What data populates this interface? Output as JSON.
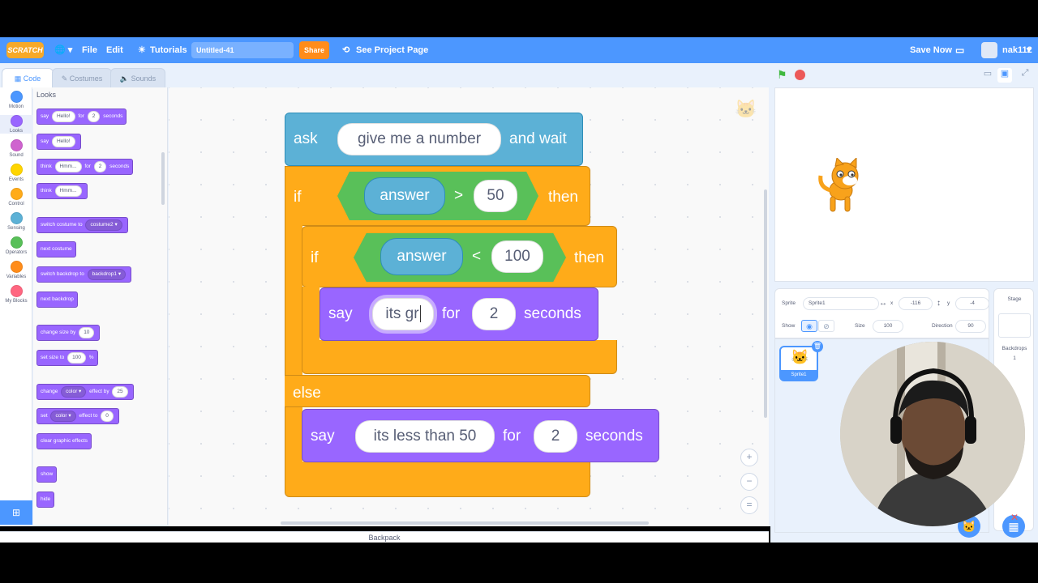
{
  "menubar": {
    "logo": "SCRATCH",
    "file": "File",
    "edit": "Edit",
    "tutorials": "Tutorials",
    "project_title": "Untitled-41",
    "share": "Share",
    "see_project_page": "See Project Page",
    "save_now": "Save Now",
    "username": "nak112"
  },
  "tabs": {
    "code": "Code",
    "costumes": "Costumes",
    "sounds": "Sounds"
  },
  "categories": [
    {
      "label": "Motion",
      "color": "#4c97ff"
    },
    {
      "label": "Looks",
      "color": "#9966ff"
    },
    {
      "label": "Sound",
      "color": "#cf63cf"
    },
    {
      "label": "Events",
      "color": "#ffd500"
    },
    {
      "label": "Control",
      "color": "#ffab19"
    },
    {
      "label": "Sensing",
      "color": "#5cb1d6"
    },
    {
      "label": "Operators",
      "color": "#59c059"
    },
    {
      "label": "Variables",
      "color": "#ff8c1a"
    },
    {
      "label": "My Blocks",
      "color": "#ff6680"
    }
  ],
  "palette": {
    "heading": "Looks",
    "say_for": {
      "say": "say",
      "msg": "Hello!",
      "for": "for",
      "secs": "2",
      "seconds": "seconds"
    },
    "say": {
      "say": "say",
      "msg": "Hello!"
    },
    "think_for": {
      "think": "think",
      "msg": "Hmm...",
      "for": "for",
      "secs": "2",
      "seconds": "seconds"
    },
    "think": {
      "think": "think",
      "msg": "Hmm..."
    },
    "switch_costume": {
      "label": "switch costume to",
      "value": "costume2"
    },
    "next_costume": "next costume",
    "switch_backdrop": {
      "label": "switch backdrop to",
      "value": "backdrop1"
    },
    "next_backdrop": "next backdrop",
    "change_size": {
      "label": "change size by",
      "value": "10"
    },
    "set_size": {
      "label": "set size to",
      "value": "100",
      "unit": "%"
    },
    "change_effect": {
      "change": "change",
      "effect": "color",
      "by": "effect by",
      "value": "25"
    },
    "set_effect": {
      "set": "set",
      "effect": "color",
      "to": "effect to",
      "value": "0"
    },
    "clear_effects": "clear graphic effects",
    "show": "show",
    "hide": "hide"
  },
  "script": {
    "ask": {
      "ask": "ask",
      "question": "give me a number",
      "wait": "and wait"
    },
    "if1": {
      "if": "if",
      "reporter": "answer",
      "op": ">",
      "value": "50",
      "then": "then"
    },
    "if2": {
      "if": "if",
      "reporter": "answer",
      "op": "<",
      "value": "100",
      "then": "then"
    },
    "say1": {
      "say": "say",
      "msg": "its gr",
      "for": "for",
      "secs": "2",
      "seconds": "seconds"
    },
    "else": "else",
    "say2": {
      "say": "say",
      "msg": "its less than 50",
      "for": "for",
      "secs": "2",
      "seconds": "seconds"
    }
  },
  "zoom": {
    "in": "+",
    "out": "−",
    "reset": "="
  },
  "backpack": "Backpack",
  "sprite_info": {
    "sprite_label": "Sprite",
    "sprite_name": "Sprite1",
    "x_label": "x",
    "x": "-116",
    "y_label": "y",
    "y": "-4",
    "show_label": "Show",
    "size_label": "Size",
    "size": "100",
    "direction_label": "Direction",
    "direction": "90"
  },
  "sprite_list": [
    {
      "name": "Sprite1"
    }
  ],
  "stage_panel": {
    "title": "Stage",
    "backdrops_label": "Backdrops",
    "backdrops_count": "1"
  },
  "colors": {
    "motion": "#4c97ff",
    "looks": "#9966ff",
    "control": "#ffab19",
    "operators": "#59c059",
    "sensing": "#5cb1d6",
    "menubar": "#4c97ff"
  }
}
